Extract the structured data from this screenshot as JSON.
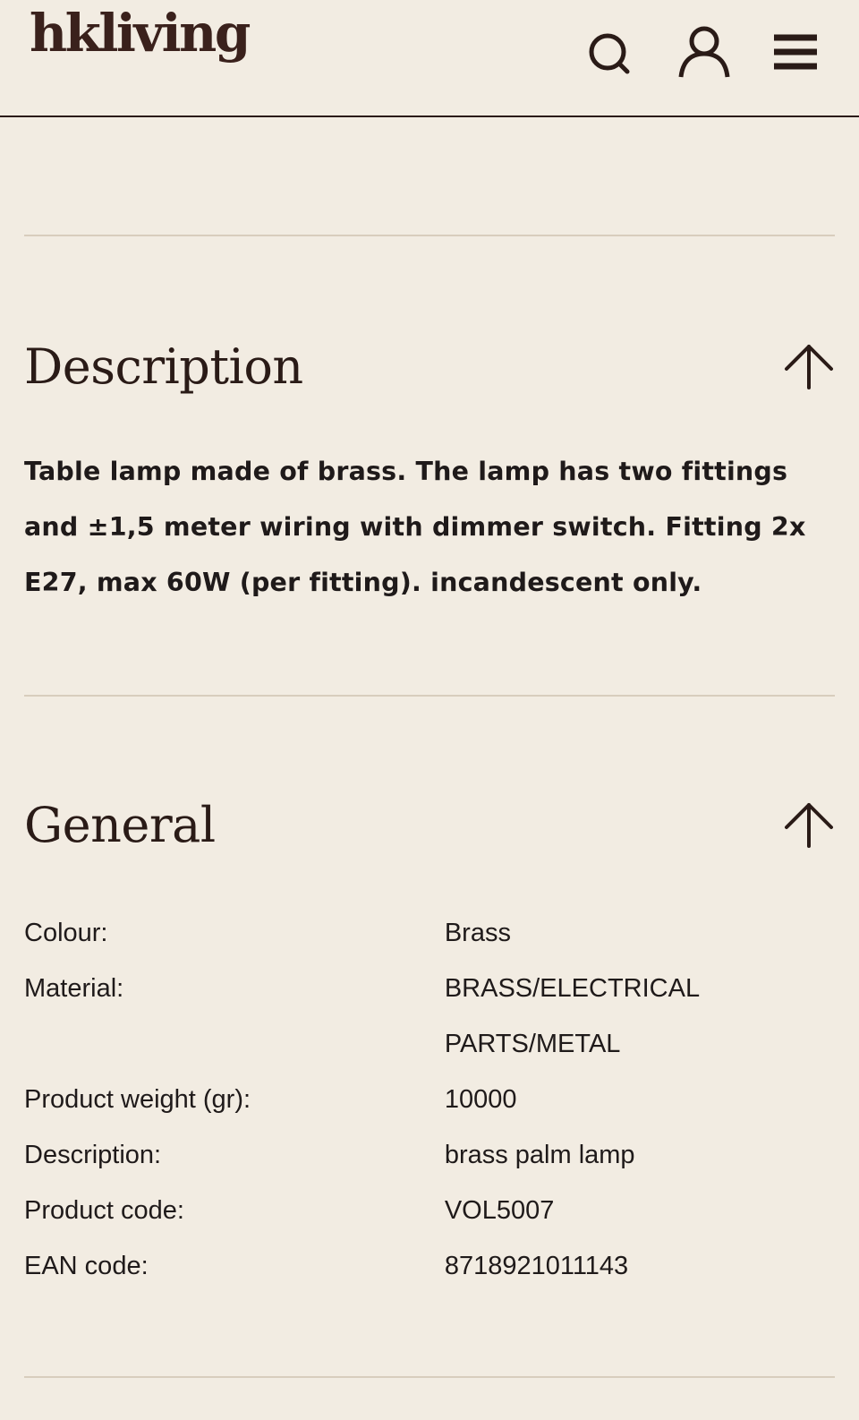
{
  "header": {
    "logo": "hkliving",
    "icons": [
      "search-icon",
      "account-icon",
      "menu-icon"
    ]
  },
  "sections": {
    "description": {
      "title": "Description",
      "text": "Table lamp made of brass. The lamp has two fittings and ±1,5 meter wiring with dimmer switch. Fitting 2x E27, max 60W (per fitting). incandescent only.",
      "expanded": true
    },
    "general": {
      "title": "General",
      "expanded": true,
      "specs": [
        {
          "label": "Colour:",
          "value": "Brass"
        },
        {
          "label": "Material:",
          "value": "BRASS/ELECTRICAL PARTS/METAL"
        },
        {
          "label": "Product weight (gr):",
          "value": "10000"
        },
        {
          "label": "Description:",
          "value": "brass palm lamp"
        },
        {
          "label": "Product code:",
          "value": "VOL5007"
        },
        {
          "label": "EAN code:",
          "value": "8718921011143"
        }
      ]
    }
  },
  "colors": {
    "background": "#f2ece2",
    "text": "#2a1b17",
    "divider": "#d8cdbd"
  }
}
